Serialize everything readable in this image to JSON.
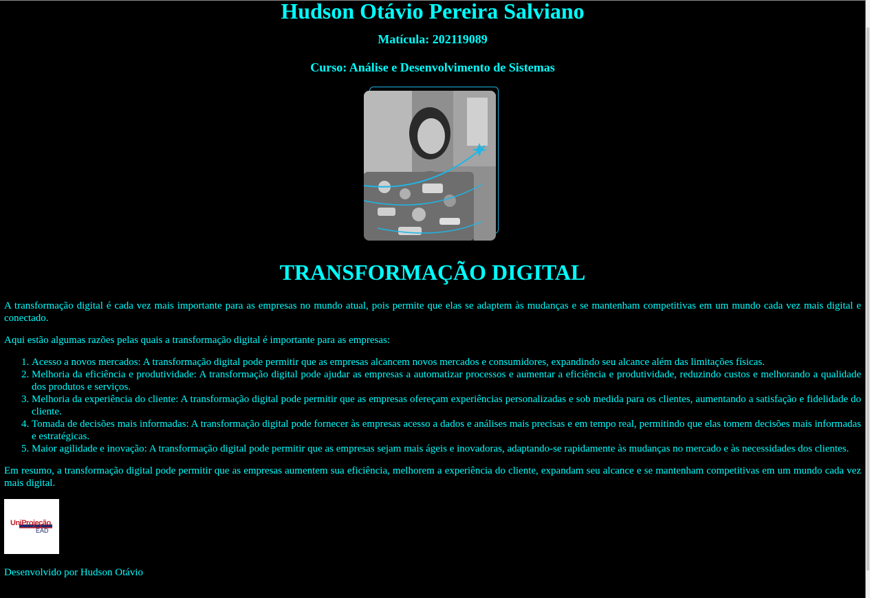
{
  "header": {
    "name": "Hudson Otávio Pereira Salviano",
    "matricula": "Matícula: 202119089",
    "curso": "Curso: Análise e Desenvolvimento de Sistemas"
  },
  "photo": {
    "alt": "Foto ilustrativa de uma mulher com notebook"
  },
  "article": {
    "title": "TRANSFORMAÇÃO DIGITAL",
    "intro": "A transformação digital é cada vez mais importante para as empresas no mundo atual, pois permite que elas se adaptem às mudanças e se mantenham competitivas em um mundo cada vez mais digital e conectado.",
    "lead": "Aqui estão algumas razões pelas quais a transformação digital é importante para as empresas:",
    "reasons": [
      "Acesso a novos mercados: A transformação digital pode permitir que as empresas alcancem novos mercados e consumidores, expandindo seu alcance além das limitações físicas.",
      "Melhoria da eficiência e produtividade: A transformação digital pode ajudar as empresas a automatizar processos e aumentar a eficiência e produtividade, reduzindo custos e melhorando a qualidade dos produtos e serviços.",
      "Melhoria da experiência do cliente: A transformação digital pode permitir que as empresas ofereçam experiências personalizadas e sob medida para os clientes, aumentando a satisfação e fidelidade do cliente.",
      "Tomada de decisões mais informadas: A transformação digital pode fornecer às empresas acesso a dados e análises mais precisas e em tempo real, permitindo que elas tomem decisões mais informadas e estratégicas.",
      "Maior agilidade e inovação: A transformação digital pode permitir que as empresas sejam mais ágeis e inovadoras, adaptando-se rapidamente às mudanças no mercado e às necessidades dos clientes."
    ],
    "conclusion": "Em resumo, a transformação digital pode permitir que as empresas aumentem sua eficiência, melhorem a experiência do cliente, expandam seu alcance e se mantenham competitivas em um mundo cada vez mais digital."
  },
  "logo": {
    "text_top": "UniProjeção",
    "text_bottom": "EAD"
  },
  "footer": {
    "credit": "Desenvolvido por Hudson Otávio"
  },
  "colors": {
    "background": "#000000",
    "text": "#00ffff",
    "accent": "#1fb6e6"
  }
}
